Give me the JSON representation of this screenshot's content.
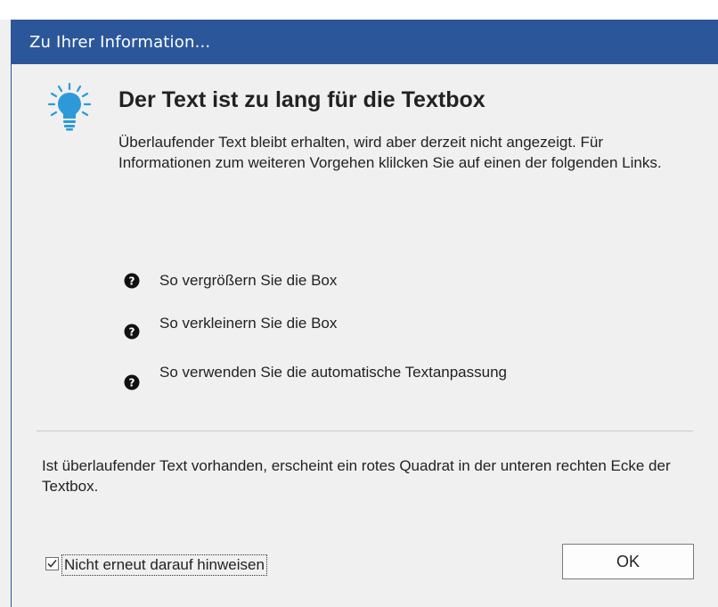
{
  "window": {
    "title": "Zu Ihrer Information..."
  },
  "main": {
    "icon": "lightbulb-icon",
    "heading": "Der Text ist zu lang für die Textbox",
    "body": "Überlaufender Text bleibt erhalten, wird aber derzeit nicht angezeigt. Für Informationen zum weiteren Vorgehen klilcken Sie auf einen der folgenden Links."
  },
  "links": [
    {
      "icon": "help-circle-icon",
      "label": "So vergrößern Sie die Box"
    },
    {
      "icon": "help-circle-icon",
      "label": "So verkleinern Sie die Box"
    },
    {
      "icon": "help-circle-icon",
      "label": "So verwenden Sie die automatische Textanpassung"
    }
  ],
  "footer": {
    "note": "Ist überlaufender Text vorhanden, erscheint ein rotes Quadrat in der unteren rechten Ecke der Textbox.",
    "checkbox_label": "Nicht erneut darauf hinweisen",
    "checkbox_checked": true,
    "ok_label": "OK"
  },
  "colors": {
    "titlebar": "#2b579a",
    "icon_blue": "#2c9ad8"
  }
}
